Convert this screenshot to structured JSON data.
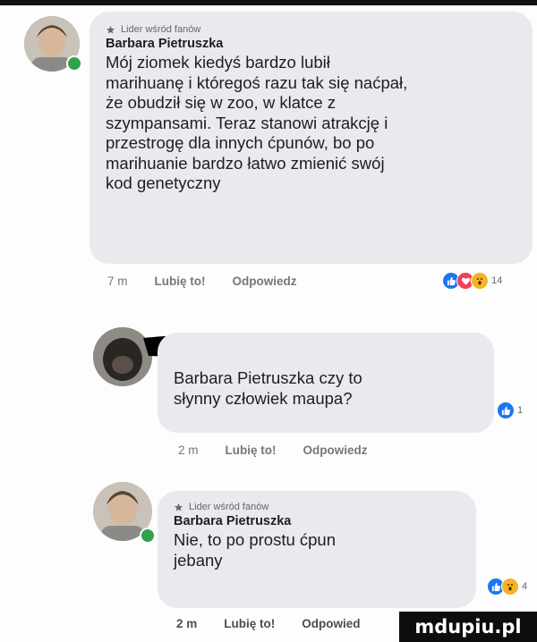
{
  "comments": [
    {
      "badge": "Lider wśród fanów",
      "author": "Barbara Pietruszka",
      "lines": [
        "Mój ziomek kiedyś bardzo lubił",
        "marihuanę i któregoś razu tak się naćpał,",
        "że obudził się w zoo, w klatce z",
        "szympansami. Teraz stanowi atrakcję i",
        "przestrogę dla innych ćpunów, bo po",
        "marihuanie bardzo łatwo zmienić swój",
        "kod genetyczny"
      ],
      "time": "7 m",
      "like": "Lubię to!",
      "reply": "Odpowiedz",
      "reaction_icons": [
        "like-icon",
        "love-icon",
        "wow-icon"
      ],
      "reaction_count": "14"
    },
    {
      "author": "Barbara Pietruszka",
      "lines": [
        "czy to",
        "słynny człowiek maupa?"
      ],
      "time": "2 m",
      "like": "Lubię to!",
      "reply": "Odpowiedz",
      "reaction_icons": [
        "like-icon"
      ],
      "reaction_count": "1"
    },
    {
      "badge": "Lider wśród fanów",
      "author": "Barbara Pietruszka",
      "lines": [
        "Nie, to po prostu ćpun",
        "jebany"
      ],
      "time": "2 m",
      "like": "Lubię to!",
      "reply": "Odpowied",
      "reaction_icons": [
        "like-icon",
        "wow-icon"
      ],
      "reaction_count": "4"
    }
  ],
  "watermark": "mdupiu.pl",
  "colors": {
    "bubble": "#e9eaee",
    "like": "#1877f2",
    "love": "#f33e58",
    "wow": "#f7b125",
    "online": "#31a24c"
  }
}
